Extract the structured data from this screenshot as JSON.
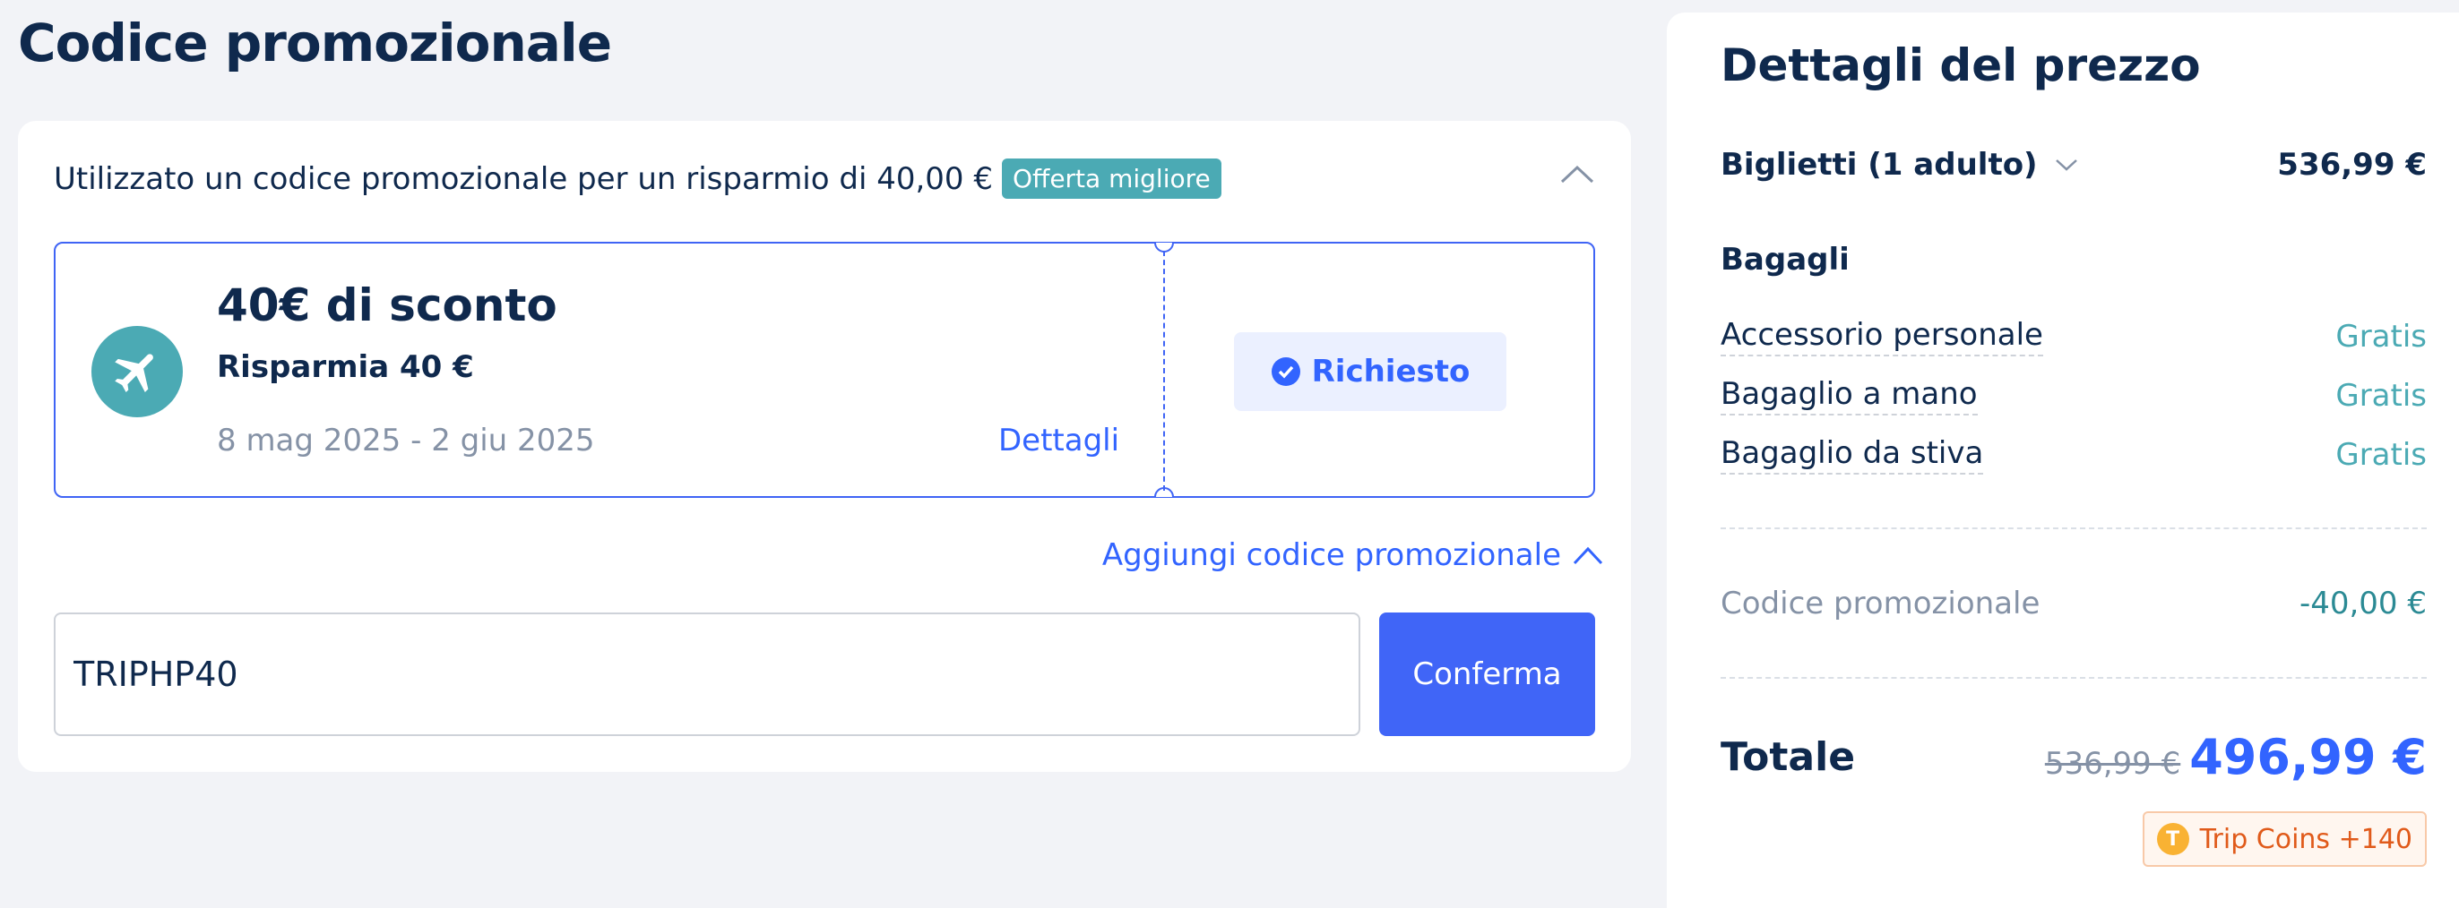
{
  "page": {
    "title": "Codice promozionale"
  },
  "promo": {
    "summary": "Utilizzato un codice promozionale per un risparmio di 40,00 €",
    "badge": "Offerta migliore",
    "coupon": {
      "title": "40€ di sconto",
      "subtitle": "Risparmia 40 €",
      "dates": "8 mag 2025 - 2 giu 2025",
      "details_link": "Dettagli",
      "status_label": "Richiesto",
      "icon": "airplane-icon"
    },
    "add_code_label": "Aggiungi codice promozionale",
    "input_value": "TRIPHP40",
    "confirm_label": "Conferma"
  },
  "price": {
    "title": "Dettagli del prezzo",
    "tickets": {
      "label": "Biglietti (1 adulto)",
      "value": "536,99 €"
    },
    "baggage_heading": "Bagagli",
    "baggage": [
      {
        "label": "Accessorio personale",
        "value": "Gratis"
      },
      {
        "label": "Bagaglio a mano",
        "value": "Gratis"
      },
      {
        "label": "Bagaglio da stiva",
        "value": "Gratis"
      }
    ],
    "promo_row": {
      "label": "Codice promozionale",
      "value": "-40,00 €"
    },
    "total": {
      "label": "Totale",
      "old_value": "536,99 €",
      "value": "496,99 €"
    },
    "coins": {
      "icon_letter": "T",
      "label": "Trip Coins +140"
    }
  },
  "colors": {
    "accent": "#3264ff",
    "teal": "#4baab4",
    "navy": "#0f294d"
  }
}
